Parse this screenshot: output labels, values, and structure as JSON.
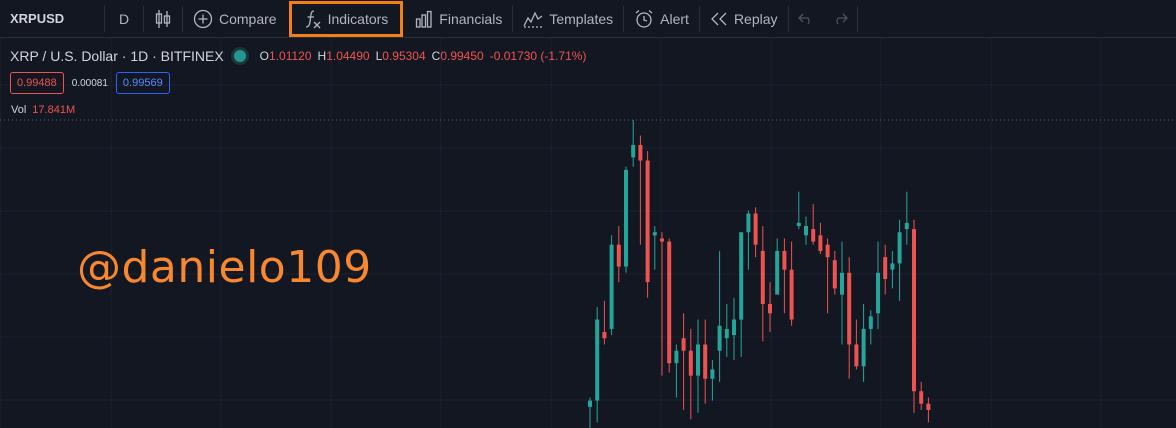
{
  "toolbar": {
    "symbol": "XRPUSD",
    "interval": "D",
    "compare_label": "Compare",
    "indicators_label": "Indicators",
    "financials_label": "Financials",
    "templates_label": "Templates",
    "alert_label": "Alert",
    "replay_label": "Replay",
    "highlight_color": "#f57f17"
  },
  "legend": {
    "title": "XRP / U.S. Dollar · 1D · BITFINEX",
    "open_label": "O",
    "open": "1.01120",
    "high_label": "H",
    "high": "1.04490",
    "low_label": "L",
    "low": "0.95304",
    "close_label": "C",
    "close": "0.99450",
    "change": "-0.01730 (-1.71%)",
    "bid": "0.99488",
    "spread": "0.00081",
    "ask": "0.99569",
    "vol_label": "Vol",
    "vol_value": "17.841M"
  },
  "watermark": "@danielo109",
  "colors": {
    "background": "#131722",
    "up": "#26a69a",
    "down": "#ef5350",
    "grid": "#1e222d",
    "text": "#d1d4dc"
  },
  "chart_data": {
    "type": "candlestick",
    "price_range": [
      0.9,
      1.92
    ],
    "candles": [
      {
        "o": 1.0,
        "h": 1.03,
        "l": 0.9,
        "c": 1.02,
        "up": true
      },
      {
        "o": 1.02,
        "h": 1.32,
        "l": 0.95,
        "c": 1.28,
        "up": true
      },
      {
        "o": 1.24,
        "h": 1.34,
        "l": 1.2,
        "c": 1.22,
        "up": false
      },
      {
        "o": 1.25,
        "h": 1.55,
        "l": 1.23,
        "c": 1.52,
        "up": true
      },
      {
        "o": 1.52,
        "h": 1.58,
        "l": 1.4,
        "c": 1.45,
        "up": false
      },
      {
        "o": 1.45,
        "h": 1.77,
        "l": 1.43,
        "c": 1.76,
        "up": true
      },
      {
        "o": 1.8,
        "h": 1.92,
        "l": 1.77,
        "c": 1.84,
        "up": true
      },
      {
        "o": 1.84,
        "h": 1.87,
        "l": 1.52,
        "c": 1.79,
        "up": false
      },
      {
        "o": 1.79,
        "h": 1.82,
        "l": 1.35,
        "c": 1.4,
        "up": false
      },
      {
        "o": 1.55,
        "h": 1.58,
        "l": 1.44,
        "c": 1.56,
        "up": true
      },
      {
        "o": 1.54,
        "h": 1.56,
        "l": 1.1,
        "c": 1.53,
        "up": false
      },
      {
        "o": 1.53,
        "h": 1.54,
        "l": 1.11,
        "c": 1.14,
        "up": false
      },
      {
        "o": 1.14,
        "h": 1.2,
        "l": 1.03,
        "c": 1.18,
        "up": true
      },
      {
        "o": 1.22,
        "h": 1.3,
        "l": 0.99,
        "c": 1.18,
        "up": false
      },
      {
        "o": 1.18,
        "h": 1.25,
        "l": 0.96,
        "c": 1.1,
        "up": false
      },
      {
        "o": 1.1,
        "h": 1.28,
        "l": 0.98,
        "c": 1.2,
        "up": true
      },
      {
        "o": 1.2,
        "h": 1.28,
        "l": 1.01,
        "c": 1.09,
        "up": false
      },
      {
        "o": 1.09,
        "h": 1.15,
        "l": 1.02,
        "c": 1.12,
        "up": true
      },
      {
        "o": 1.18,
        "h": 1.5,
        "l": 1.08,
        "c": 1.26,
        "up": true
      },
      {
        "o": 1.22,
        "h": 1.33,
        "l": 1.16,
        "c": 1.25,
        "up": true
      },
      {
        "o": 1.23,
        "h": 1.35,
        "l": 1.15,
        "c": 1.28,
        "up": true
      },
      {
        "o": 1.28,
        "h": 1.55,
        "l": 1.16,
        "c": 1.56,
        "up": true
      },
      {
        "o": 1.56,
        "h": 1.63,
        "l": 1.44,
        "c": 1.62,
        "up": true
      },
      {
        "o": 1.62,
        "h": 1.64,
        "l": 1.48,
        "c": 1.52,
        "up": false
      },
      {
        "o": 1.5,
        "h": 1.58,
        "l": 1.21,
        "c": 1.33,
        "up": false
      },
      {
        "o": 1.33,
        "h": 1.4,
        "l": 1.24,
        "c": 1.3,
        "up": false
      },
      {
        "o": 1.36,
        "h": 1.54,
        "l": 1.36,
        "c": 1.5,
        "up": true
      },
      {
        "o": 1.5,
        "h": 1.54,
        "l": 1.3,
        "c": 1.44,
        "up": false
      },
      {
        "o": 1.44,
        "h": 1.53,
        "l": 1.26,
        "c": 1.28,
        "up": false
      },
      {
        "o": 1.58,
        "h": 1.69,
        "l": 1.57,
        "c": 1.59,
        "up": true
      },
      {
        "o": 1.58,
        "h": 1.61,
        "l": 1.52,
        "c": 1.55,
        "up": true
      },
      {
        "o": 1.57,
        "h": 1.65,
        "l": 1.52,
        "c": 1.53,
        "up": false
      },
      {
        "o": 1.55,
        "h": 1.59,
        "l": 1.49,
        "c": 1.5,
        "up": false
      },
      {
        "o": 1.52,
        "h": 1.54,
        "l": 1.3,
        "c": 1.48,
        "up": false
      },
      {
        "o": 1.47,
        "h": 1.5,
        "l": 1.36,
        "c": 1.38,
        "up": false
      },
      {
        "o": 1.36,
        "h": 1.53,
        "l": 1.2,
        "c": 1.43,
        "up": true
      },
      {
        "o": 1.43,
        "h": 1.48,
        "l": 1.09,
        "c": 1.2,
        "up": false
      },
      {
        "o": 1.2,
        "h": 1.28,
        "l": 1.12,
        "c": 1.13,
        "up": false
      },
      {
        "o": 1.13,
        "h": 1.33,
        "l": 1.08,
        "c": 1.25,
        "up": true
      },
      {
        "o": 1.25,
        "h": 1.31,
        "l": 1.2,
        "c": 1.29,
        "up": true
      },
      {
        "o": 1.3,
        "h": 1.53,
        "l": 1.25,
        "c": 1.43,
        "up": true
      },
      {
        "o": 1.48,
        "h": 1.52,
        "l": 1.36,
        "c": 1.41,
        "up": false
      },
      {
        "o": 1.44,
        "h": 1.5,
        "l": 1.38,
        "c": 1.46,
        "up": true
      },
      {
        "o": 1.46,
        "h": 1.6,
        "l": 1.34,
        "c": 1.56,
        "up": true
      },
      {
        "o": 1.59,
        "h": 1.69,
        "l": 1.52,
        "c": 1.57,
        "up": true
      },
      {
        "o": 1.57,
        "h": 1.6,
        "l": 0.98,
        "c": 1.05,
        "up": false
      },
      {
        "o": 1.05,
        "h": 1.08,
        "l": 0.99,
        "c": 1.01,
        "up": false
      },
      {
        "o": 1.01,
        "h": 1.03,
        "l": 0.95,
        "c": 0.99,
        "up": false
      }
    ]
  }
}
